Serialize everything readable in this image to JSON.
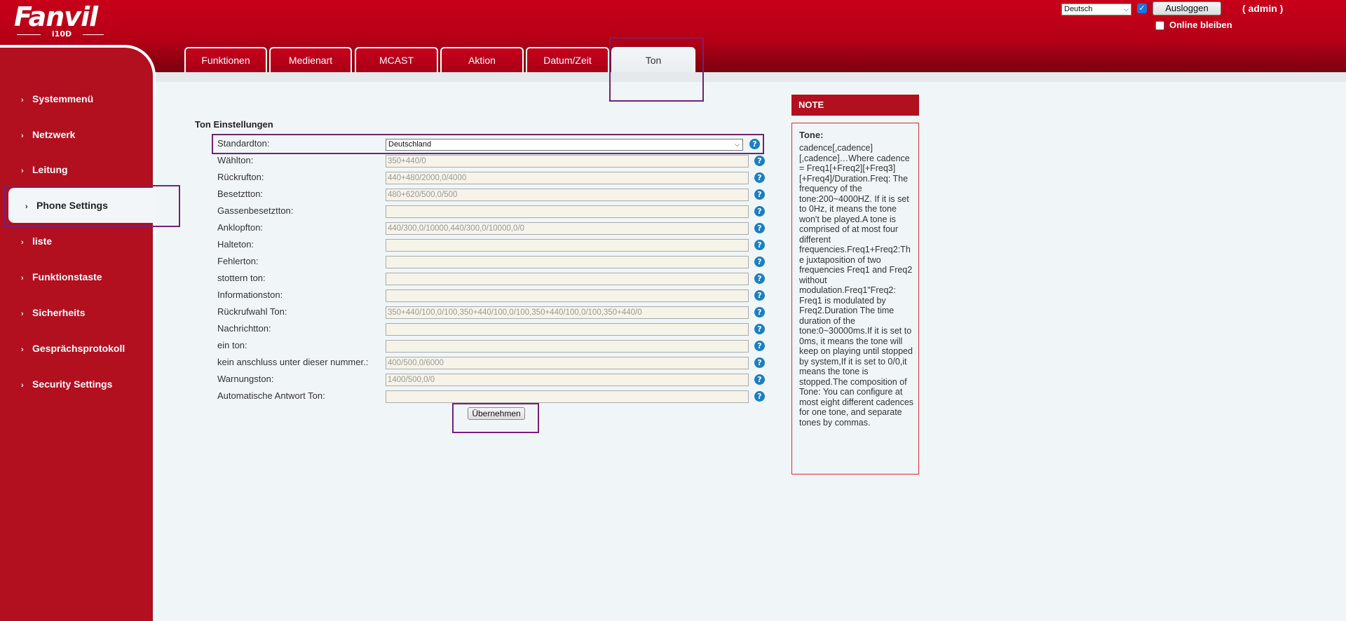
{
  "header": {
    "logo_text": "Fanvil",
    "logo_model": "i10D",
    "language_value": "Deutsch",
    "logout_label": "Ausloggen",
    "user_label": "( admin )",
    "online_label": "Online bleiben",
    "brand_color": "#b20f1f"
  },
  "tabs": [
    {
      "label": "Funktionen"
    },
    {
      "label": "Medienart"
    },
    {
      "label": "MCAST"
    },
    {
      "label": "Aktion"
    },
    {
      "label": "Datum/Zeit"
    },
    {
      "label": "Ton",
      "active": true
    }
  ],
  "sidebar": {
    "items": [
      {
        "label": "Systemmenü"
      },
      {
        "label": "Netzwerk"
      },
      {
        "label": "Leitung"
      },
      {
        "label": "Phone Settings",
        "active": true
      },
      {
        "label": "liste"
      },
      {
        "label": "Funktionstaste"
      },
      {
        "label": "Sicherheits"
      },
      {
        "label": "Gesprächsprotokoll"
      },
      {
        "label": "Security Settings"
      }
    ]
  },
  "form": {
    "section_title": "Ton Einstellungen",
    "standard_tone": {
      "label": "Standardton:",
      "value": "Deutschland"
    },
    "rows": [
      {
        "label": "Wählton:",
        "value": "350+440/0"
      },
      {
        "label": "Rückrufton:",
        "value": "440+480/2000,0/4000"
      },
      {
        "label": "Besetztton:",
        "value": "480+620/500,0/500"
      },
      {
        "label": "Gassenbesetztton:",
        "value": ""
      },
      {
        "label": "Anklopfton:",
        "value": "440/300,0/10000,440/300,0/10000,0/0"
      },
      {
        "label": "Halteton:",
        "value": ""
      },
      {
        "label": "Fehlerton:",
        "value": ""
      },
      {
        "label": "stottern ton:",
        "value": ""
      },
      {
        "label": "Informationston:",
        "value": ""
      },
      {
        "label": "Rückrufwahl Ton:",
        "value": "350+440/100,0/100,350+440/100,0/100,350+440/100,0/100,350+440/0"
      },
      {
        "label": "Nachrichtton:",
        "value": ""
      },
      {
        "label": "ein ton:",
        "value": ""
      },
      {
        "label": "kein anschluss unter dieser nummer.:",
        "value": "400/500,0/6000"
      },
      {
        "label": "Warnungston:",
        "value": "1400/500,0/0"
      },
      {
        "label": "Automatische Antwort Ton:",
        "value": ""
      }
    ],
    "apply_label": "Übernehmen",
    "help_glyph": "?"
  },
  "note": {
    "header": "NOTE",
    "title": "Tone:",
    "text": "cadence[,cadence][,cadence]…Where cadence = Freq1[+Freq2][+Freq3][+Freq4]/Duration.Freq: The frequency of the tone:200~4000HZ.  If it is set to 0Hz, it means the tone won't be played.A tone is comprised of at most four different frequencies.Freq1+Freq2:The juxtaposition of two frequencies Freq1 and Freq2 without modulation.Freq1\"Freq2: Freq1 is modulated by Freq2.Duration The time duration of the tone:0~30000ms.If it is set to 0ms, it means the tone will keep on playing until stopped by system,If it is set to 0/0,it means the tone is stopped.The composition of Tone: You can configure at most eight different cadences for one tone, and separate tones by commas."
  }
}
